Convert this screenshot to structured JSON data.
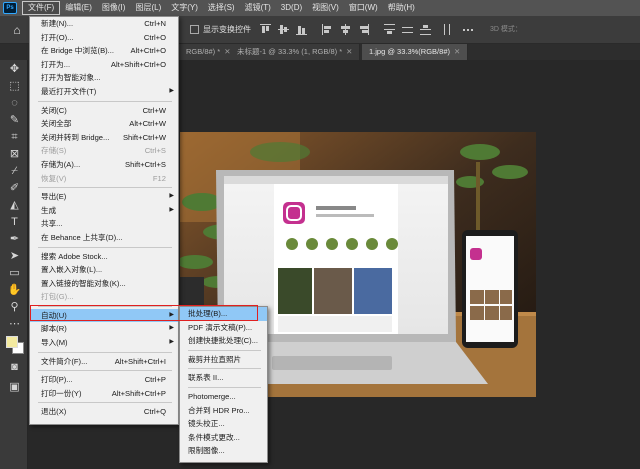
{
  "menubar": {
    "logo": "Ps",
    "items": [
      {
        "label": "文件(F)"
      },
      {
        "label": "编辑(E)"
      },
      {
        "label": "图像(I)"
      },
      {
        "label": "图层(L)"
      },
      {
        "label": "文字(Y)"
      },
      {
        "label": "选择(S)"
      },
      {
        "label": "滤镜(T)"
      },
      {
        "label": "3D(D)"
      },
      {
        "label": "视图(V)"
      },
      {
        "label": "窗口(W)"
      },
      {
        "label": "帮助(H)"
      }
    ]
  },
  "options": {
    "show_transform_label": "显示变换控件",
    "mode_3d_label": "3D 模式："
  },
  "tabs": [
    {
      "label": "RGB/8#) *"
    },
    {
      "label": "未标题-1 @ 33.3% (1, RGB/8) *"
    },
    {
      "label": "1.jpg @ 33.3%(RGB/8#)"
    }
  ],
  "file_menu": {
    "items": [
      {
        "label": "新建(N)...",
        "shortcut": "Ctrl+N"
      },
      {
        "label": "打开(O)...",
        "shortcut": "Ctrl+O"
      },
      {
        "label": "在 Bridge 中浏览(B)...",
        "shortcut": "Alt+Ctrl+O"
      },
      {
        "label": "打开为...",
        "shortcut": "Alt+Shift+Ctrl+O"
      },
      {
        "label": "打开为智能对象..."
      },
      {
        "label": "最近打开文件(T)"
      },
      {
        "label": "关闭(C)",
        "shortcut": "Ctrl+W"
      },
      {
        "label": "关闭全部",
        "shortcut": "Alt+Ctrl+W"
      },
      {
        "label": "关闭并转到 Bridge...",
        "shortcut": "Shift+Ctrl+W"
      },
      {
        "label": "存储(S)",
        "shortcut": "Ctrl+S"
      },
      {
        "label": "存储为(A)...",
        "shortcut": "Shift+Ctrl+S"
      },
      {
        "label": "恢复(V)",
        "shortcut": "F12"
      },
      {
        "label": "导出(E)"
      },
      {
        "label": "生成"
      },
      {
        "label": "共享..."
      },
      {
        "label": "在 Behance 上共享(D)..."
      },
      {
        "label": "搜索 Adobe Stock..."
      },
      {
        "label": "置入嵌入对象(L)..."
      },
      {
        "label": "置入链接的智能对象(K)..."
      },
      {
        "label": "打包(G)..."
      },
      {
        "label": "自动(U)"
      },
      {
        "label": "脚本(R)"
      },
      {
        "label": "导入(M)"
      },
      {
        "label": "文件简介(F)...",
        "shortcut": "Alt+Shift+Ctrl+I"
      },
      {
        "label": "打印(P)...",
        "shortcut": "Ctrl+P"
      },
      {
        "label": "打印一份(Y)",
        "shortcut": "Alt+Shift+Ctrl+P"
      },
      {
        "label": "退出(X)",
        "shortcut": "Ctrl+Q"
      }
    ]
  },
  "automate_menu": {
    "items": [
      {
        "label": "批处理(B)..."
      },
      {
        "label": "PDF 演示文稿(P)..."
      },
      {
        "label": "创建快捷批处理(C)..."
      },
      {
        "label": "裁剪并拉直照片"
      },
      {
        "label": "联系表 II..."
      },
      {
        "label": "Photomerge..."
      },
      {
        "label": "合并到 HDR Pro..."
      },
      {
        "label": "镜头校正..."
      },
      {
        "label": "条件模式更改..."
      },
      {
        "label": "限制图像..."
      }
    ]
  },
  "colors": {
    "highlight": "#90c8f6",
    "annotation_box": "#e02020",
    "foreground": "#f3eaa0",
    "background": "#ffffff"
  }
}
